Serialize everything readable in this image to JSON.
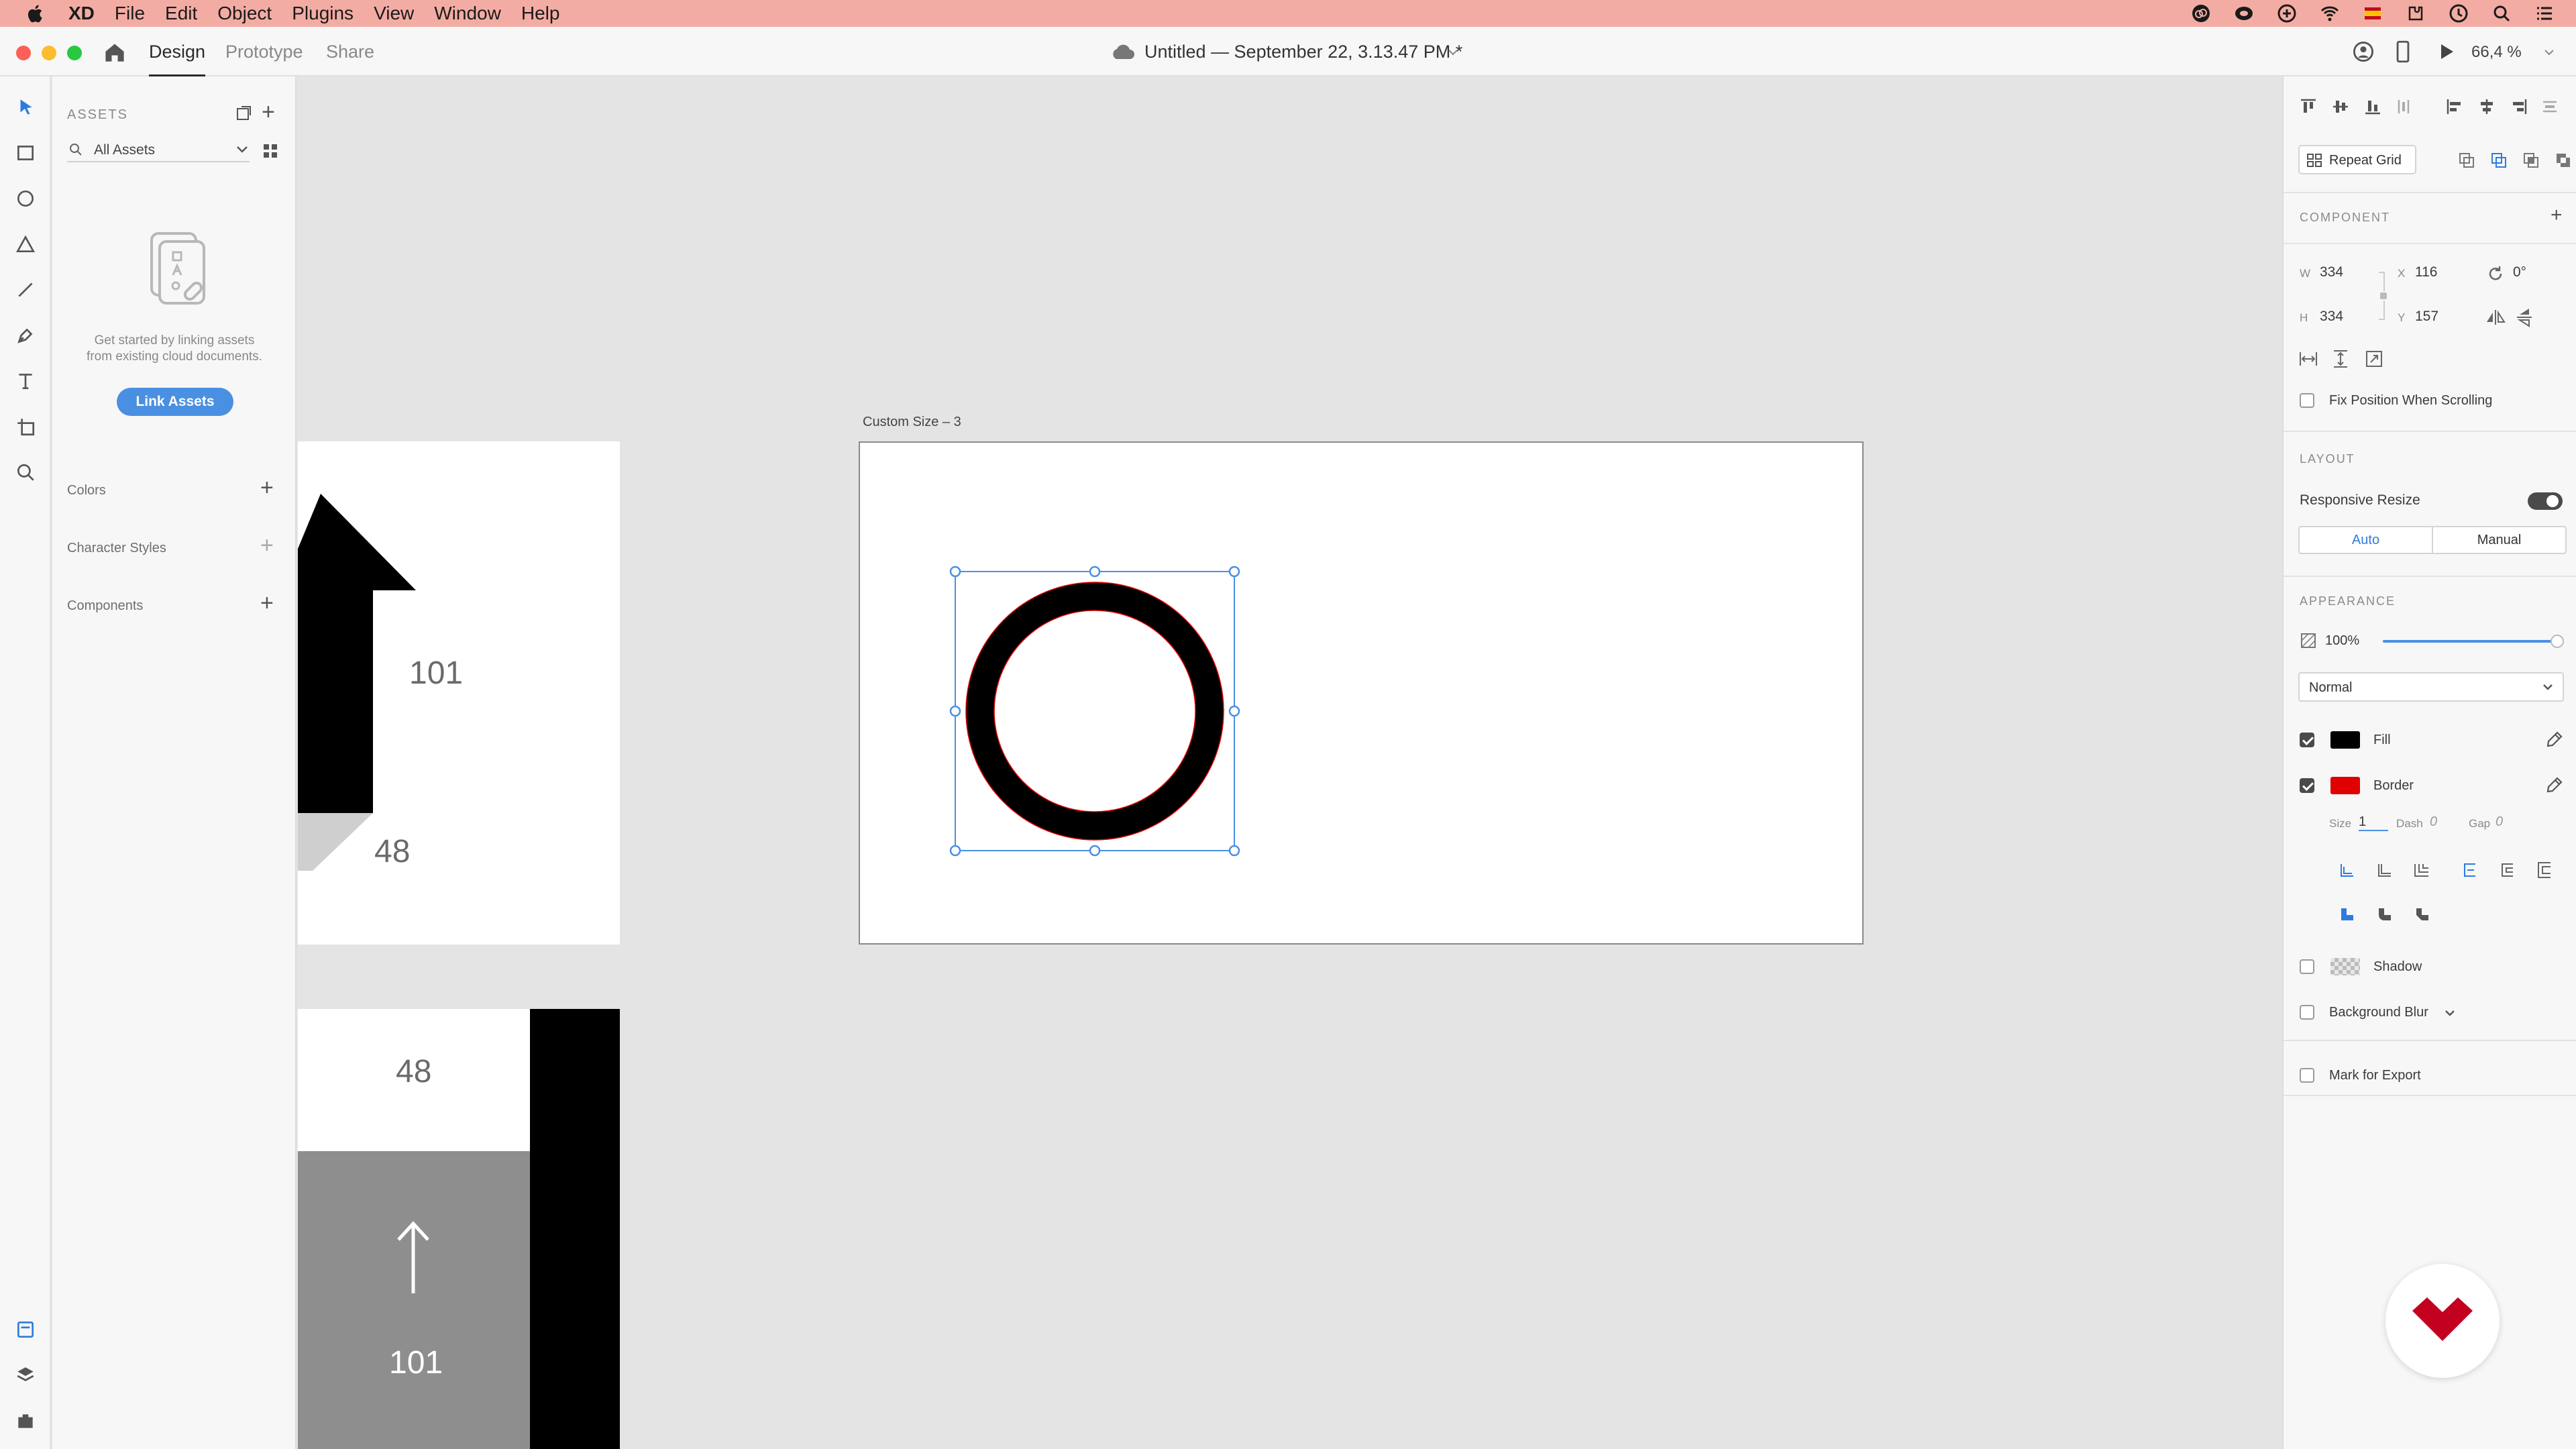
{
  "menubar": {
    "app_name": "XD",
    "items": [
      "File",
      "Edit",
      "Object",
      "Plugins",
      "View",
      "Window",
      "Help"
    ]
  },
  "titlebar": {
    "tabs": [
      "Design",
      "Prototype",
      "Share"
    ],
    "document_title": "Untitled — September 22, 3.13.47 PM *",
    "zoom": "66,4 %"
  },
  "assets": {
    "header": "ASSETS",
    "filter_label": "All Assets",
    "empty_text_line1": "Get started by linking assets",
    "empty_text_line2": "from existing cloud documents.",
    "link_button": "Link Assets",
    "sections": [
      "Colors",
      "Character Styles",
      "Components"
    ]
  },
  "canvas": {
    "artboard_label": "Custom Size – 3",
    "left_artboard_numbers": {
      "top": "101",
      "bottom": "48"
    },
    "lower_artboard_numbers": {
      "top": "48",
      "bottom": "101"
    }
  },
  "props": {
    "repeat_grid_label": "Repeat Grid",
    "component_label": "COMPONENT",
    "w_label": "W",
    "w_value": "334",
    "h_label": "H",
    "h_value": "334",
    "x_label": "X",
    "x_value": "116",
    "y_label": "Y",
    "y_value": "157",
    "rotation_value": "0°",
    "fix_position_label": "Fix Position When Scrolling",
    "layout_label": "LAYOUT",
    "responsive_resize_label": "Responsive Resize",
    "auto_label": "Auto",
    "manual_label": "Manual",
    "appearance_label": "APPEARANCE",
    "opacity_value": "100%",
    "opacity_level": 1.0,
    "blend_mode": "Normal",
    "fill_label": "Fill",
    "fill_color": "#000000",
    "border_label": "Border",
    "border_color": "#e10000",
    "size_label": "Size",
    "size_value": "1",
    "dash_label": "Dash",
    "dash_value": "0",
    "gap_label": "Gap",
    "gap_value": "0",
    "shadow_label": "Shadow",
    "background_blur_label": "Background Blur",
    "mark_export_label": "Mark for Export"
  },
  "colors": {
    "accent": "#4a90e2",
    "menubar_bg": "#f3aca3",
    "brand_red": "#c3001f"
  }
}
